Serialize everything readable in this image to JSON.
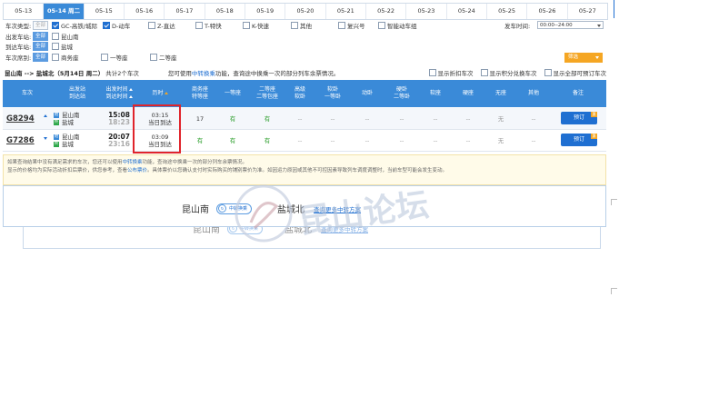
{
  "date_tabs": [
    {
      "label": "05-13",
      "active": false
    },
    {
      "label": "05-14 周二",
      "active": true
    },
    {
      "label": "05-15",
      "active": false
    },
    {
      "label": "05-16",
      "active": false
    },
    {
      "label": "05-17",
      "active": false
    },
    {
      "label": "05-18",
      "active": false
    },
    {
      "label": "05-19",
      "active": false
    },
    {
      "label": "05-20",
      "active": false
    },
    {
      "label": "05-21",
      "active": false
    },
    {
      "label": "05-22",
      "active": false
    },
    {
      "label": "05-23",
      "active": false
    },
    {
      "label": "05-24",
      "active": false
    },
    {
      "label": "05-25",
      "active": false
    },
    {
      "label": "05-26",
      "active": false
    },
    {
      "label": "05-27",
      "active": false
    }
  ],
  "filters": {
    "train_type_label": "车次类型:",
    "all_label": "全部",
    "train_types": [
      {
        "label": "GC-高铁/城际",
        "checked": true
      },
      {
        "label": "D-动车",
        "checked": true
      },
      {
        "label": "Z-直达",
        "checked": false
      },
      {
        "label": "T-特快",
        "checked": false
      },
      {
        "label": "K-快速",
        "checked": false
      },
      {
        "label": "其他",
        "checked": false
      },
      {
        "label": "复兴号",
        "checked": false
      },
      {
        "label": "智能动车组",
        "checked": false
      }
    ],
    "depart_time_label": "发车时间:",
    "depart_time_value": "00:00--24:00",
    "from_label": "出发车站:",
    "from_station": "昆山南",
    "to_label": "到达车站:",
    "to_station": "盐城",
    "seat_label": "车次席别:",
    "seats": [
      "商务座",
      "一等座",
      "二等座"
    ],
    "filter_button": "筛选"
  },
  "summary": {
    "route": "昆山南 --> 盐城北（5月14日 周二）",
    "count": "共计2个车次",
    "hint_prefix": "您可使用",
    "hint_link": "中转换乘",
    "hint_suffix": "功能，查询途中换乘一次的部分列车余票情况。",
    "options": [
      "显示折扣车次",
      "显示积分兑换车次",
      "显示全部可预订车次"
    ]
  },
  "table_headers": {
    "train": "车次",
    "stations": [
      "出发站",
      "到达站"
    ],
    "times": [
      "出发时间",
      "到达时间"
    ],
    "duration": "历时",
    "business": [
      "商务座",
      "特等座"
    ],
    "first": "一等座",
    "second": [
      "二等座",
      "二等包座"
    ],
    "premium_soft": [
      "高级",
      "软卧"
    ],
    "soft_sleeper": [
      "软卧",
      "一等卧"
    ],
    "emu_sleeper": "动卧",
    "hard_sleeper": [
      "硬卧",
      "二等卧"
    ],
    "soft_seat": "软座",
    "hard_seat": "硬座",
    "no_seat": "无座",
    "other": "其他",
    "remark": "备注"
  },
  "trains": [
    {
      "no": "G8294",
      "from": "昆山南",
      "to": "盐城",
      "dep": "15:08",
      "arr": "18:23",
      "duration": "03:15",
      "day": "当日到达",
      "business": "17",
      "first": "有",
      "second": "有",
      "premium_soft": "--",
      "soft_sleeper": "--",
      "emu_sleeper": "--",
      "hard_sleeper": "--",
      "soft_seat": "--",
      "hard_seat": "--",
      "no_seat": "无",
      "other": "--",
      "book": "预订"
    },
    {
      "no": "G7286",
      "from": "昆山南",
      "to": "盐城",
      "dep": "20:07",
      "arr": "23:16",
      "duration": "03:09",
      "day": "当日到达",
      "business": "有",
      "first": "有",
      "second": "有",
      "premium_soft": "--",
      "soft_sleeper": "--",
      "emu_sleeper": "--",
      "hard_sleeper": "--",
      "soft_seat": "--",
      "hard_seat": "--",
      "no_seat": "无",
      "other": "--",
      "book": "预订"
    }
  ],
  "notice": {
    "line1_a": "如果查询结果中没有满足需求的车次，您还可以使用",
    "line1_link": "中转换乘",
    "line1_b": "功能，查询途中换乘一次的部分列车余票情况。",
    "line2_a": "显示的价格均为实际活动折扣后票价，供您参考，查看",
    "line2_link": "公布票价",
    "line2_b": "。具体票价以您确认支付时实际购买的铺别票价为准。如因运力原因或其他不可控因素导致列车调度调整时，当前车型可能会发生变动。"
  },
  "transfer": {
    "from": "昆山南",
    "badge": "中转换乘",
    "to": "盐城北",
    "link": "查询更多中转方案"
  },
  "watermark_text": "昆山论坛",
  "colors": {
    "header_blue": "#3a8ad8",
    "book_blue": "#1f6fd1",
    "orange": "#f5a623",
    "highlight_red": "#e0242b",
    "available_green": "#2e9f2e"
  }
}
